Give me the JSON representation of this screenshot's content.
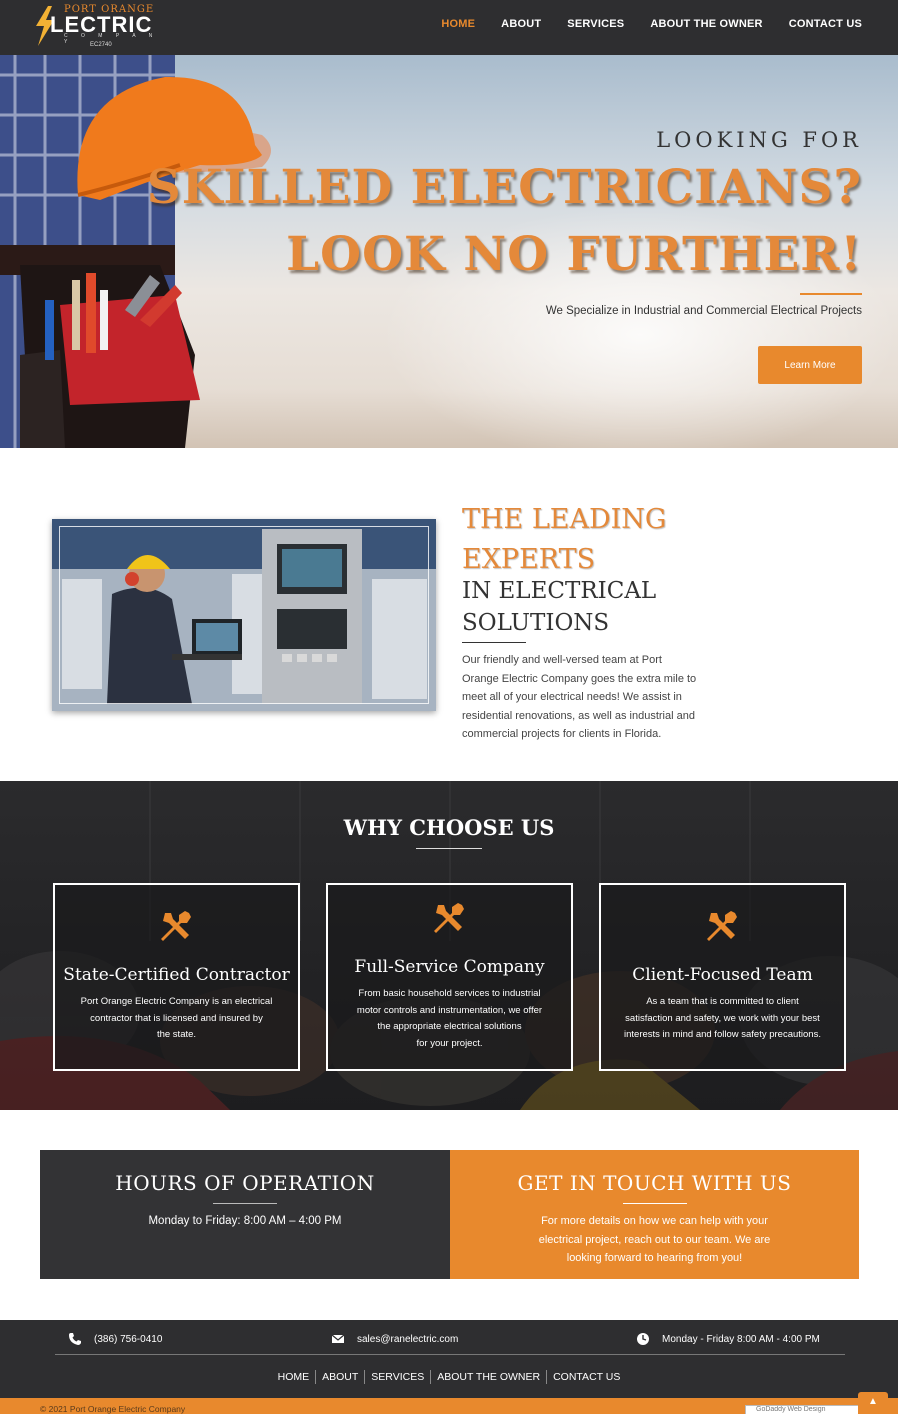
{
  "header": {
    "logo": {
      "line1": "PORT ORANGE",
      "line2": "LECTRIC",
      "line3": "C O M P A N Y",
      "license": "EC2740"
    },
    "nav": [
      {
        "label": "HOME",
        "active": true
      },
      {
        "label": "ABOUT",
        "active": false
      },
      {
        "label": "SERVICES",
        "active": false
      },
      {
        "label": "ABOUT THE OWNER",
        "active": false
      },
      {
        "label": "CONTACT US",
        "active": false
      }
    ]
  },
  "hero": {
    "kicker": "LOOKING FOR",
    "headline_1": "SKILLED ELECTRICIANS?",
    "headline_2": "LOOK NO FURTHER!",
    "subtitle": "We Specialize in Industrial and Commercial Electrical Projects",
    "cta_label": "Learn More"
  },
  "experts": {
    "title_line1": "THE LEADING",
    "title_line2": "EXPERTS",
    "subtitle_line1": "IN ELECTRICAL",
    "subtitle_line2": "SOLUTIONS",
    "body_lines": [
      "Our friendly and well-versed team at Port",
      "Orange Electric Company goes the extra mile to",
      "meet all of your electrical needs! We assist in",
      "residential renovations, as well as industrial and",
      "commercial projects for clients in Florida."
    ]
  },
  "why": {
    "title": "WHY CHOOSE US",
    "cards": [
      {
        "icon": "tools-icon",
        "title": "State-Certified Contractor",
        "lines": [
          "Port Orange Electric Company is an electrical",
          "contractor that is licensed and insured by",
          "the state."
        ]
      },
      {
        "icon": "tools-icon",
        "title": "Full-Service Company",
        "lines": [
          "From basic household services to industrial",
          "motor controls and instrumentation, we offer",
          "the appropriate electrical solutions",
          "for your project."
        ]
      },
      {
        "icon": "tools-icon",
        "title": "Client-Focused Team",
        "lines": [
          "As a team that is committed to client",
          "satisfaction and safety, we work with your best",
          "interests in mind and follow safety precautions."
        ]
      }
    ]
  },
  "hours": {
    "title": "HOURS OF OPERATION",
    "text": "Monday to Friday: 8:00 AM – 4:00 PM"
  },
  "touch": {
    "title": "GET IN TOUCH WITH US",
    "lines": [
      "For more details on how we can help with your",
      "electrical project, reach out to our team. We are",
      "looking forward to hearing from you!"
    ]
  },
  "footer": {
    "phone": "(386) 756-0410",
    "email": "sales@ranelectric.com",
    "hours": "Monday - Friday 8:00 AM - 4:00 PM",
    "nav": [
      "HOME",
      "ABOUT",
      "SERVICES",
      "ABOUT THE OWNER",
      "CONTACT US"
    ],
    "copyright": "© 2021 Port Orange Electric Company",
    "badge_alt": "GoDaddy Web Design"
  },
  "colors": {
    "accent": "#e8892d",
    "dark": "#2e2e30"
  }
}
